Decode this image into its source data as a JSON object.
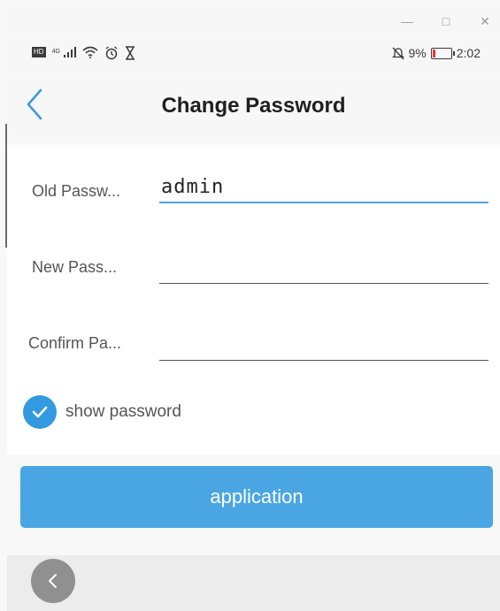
{
  "window": {
    "minimize_glyph": "—",
    "maximize_glyph": "□",
    "close_glyph": "✕"
  },
  "statusbar": {
    "network_label": "4G",
    "hd_label": "HD",
    "battery_percent": "9%",
    "battery_level": 0.09,
    "time": "2:02",
    "left_icons": [
      "hd-icon",
      "signal-icon",
      "wifi-icon",
      "alarm-icon",
      "hourglass-icon"
    ],
    "right_icons": [
      "mute-icon",
      "battery-icon"
    ]
  },
  "header": {
    "title": "Change Password",
    "back_icon": "chevron-left-icon"
  },
  "form": {
    "old_password": {
      "label": "Old Passw...",
      "value": "admin"
    },
    "new_password": {
      "label": "New Pass...",
      "value": ""
    },
    "confirm_password": {
      "label": "Confirm Pa...",
      "value": ""
    },
    "show_password": {
      "label": "show password",
      "checked": true
    }
  },
  "actions": {
    "apply_label": "application"
  },
  "colors": {
    "accent": "#4aa6e3",
    "checkbox": "#3399e0",
    "active_underline": "#4da3e6",
    "battery_low": "#e53935"
  }
}
